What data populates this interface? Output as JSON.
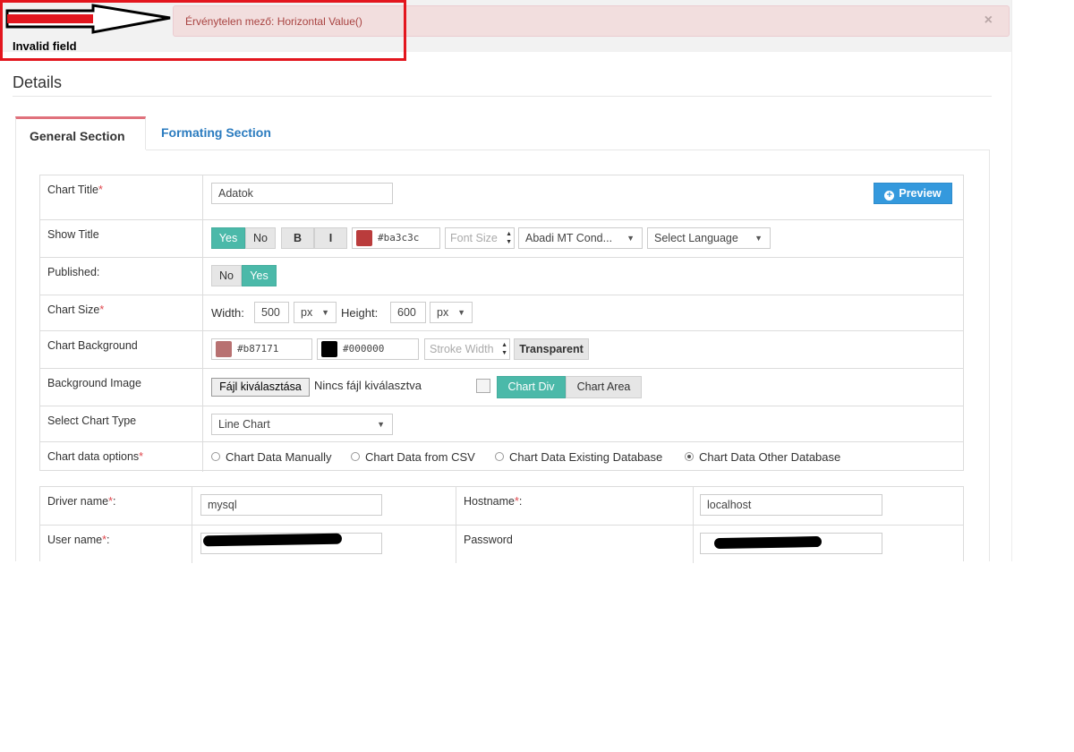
{
  "annotation": {
    "label": "Invalid field"
  },
  "alert": {
    "message": "Érvénytelen mező: Horizontal Value()",
    "close": "×"
  },
  "details": {
    "title": "Details"
  },
  "tabs": [
    {
      "label": "General Section"
    },
    {
      "label": "Formating Section"
    }
  ],
  "form": {
    "chart_title": {
      "label": "Chart Title",
      "value": "Adatok",
      "preview": "Preview"
    },
    "show_title": {
      "label": "Show Title",
      "yes": "Yes",
      "no": "No",
      "bold": "B",
      "italic": "I",
      "color": "#ba3c3c",
      "font_size_placeholder": "Font Size",
      "font": "Abadi MT Cond...",
      "language": "Select Language"
    },
    "published": {
      "label": "Published:",
      "no": "No",
      "yes": "Yes"
    },
    "chart_size": {
      "label": "Chart Size",
      "width_label": "Width:",
      "width": "500",
      "width_unit": "px",
      "height_label": "Height:",
      "height": "600",
      "height_unit": "px"
    },
    "chart_background": {
      "label": "Chart Background",
      "color": "#b87171",
      "stroke_color": "#000000",
      "stroke_placeholder": "Stroke Width",
      "transparent": "Transparent"
    },
    "background_image": {
      "label": "Background Image",
      "file_button": "Fájl kiválasztása",
      "no_file": "Nincs fájl kiválasztva",
      "chart_div": "Chart Div",
      "chart_area": "Chart Area"
    },
    "chart_type": {
      "label": "Select Chart Type",
      "value": "Line Chart"
    },
    "data_options": {
      "label": "Chart data options",
      "options": [
        "Chart Data Manually",
        "Chart Data from CSV",
        "Chart Data Existing Database",
        "Chart Data Other Database"
      ],
      "selected": "Chart Data Other Database"
    }
  },
  "db": {
    "driver": {
      "label": "Driver name",
      "value": "mysql"
    },
    "hostname": {
      "label": "Hostname",
      "value": "localhost"
    },
    "user": {
      "label": "User name"
    },
    "password": {
      "label": "Password"
    }
  },
  "colors": {
    "teal": "#4bb9a9",
    "blue": "#3499dd",
    "alert_text": "#a94442",
    "accent": "#e0717c"
  }
}
